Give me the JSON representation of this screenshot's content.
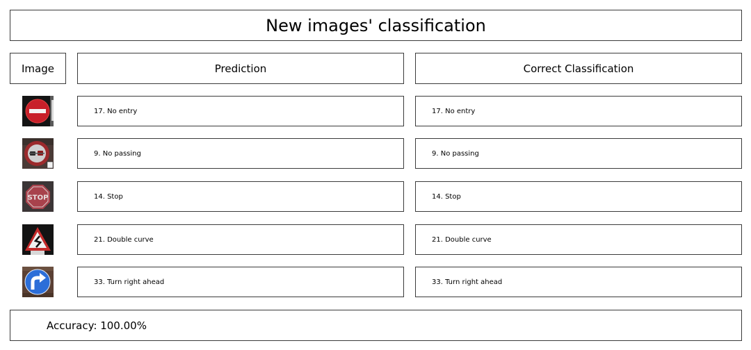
{
  "title": "New images' classification",
  "headers": {
    "image": "Image",
    "prediction": "Prediction",
    "correct": "Correct Classification"
  },
  "rows": [
    {
      "icon": "no-entry-sign-icon",
      "prediction": "17. No entry",
      "correct": "17. No entry"
    },
    {
      "icon": "no-passing-sign-icon",
      "prediction": "9. No passing",
      "correct": "9. No passing"
    },
    {
      "icon": "stop-sign-icon",
      "prediction": "14. Stop",
      "correct": "14. Stop"
    },
    {
      "icon": "double-curve-sign-icon",
      "prediction": "21. Double curve",
      "correct": "21. Double curve"
    },
    {
      "icon": "turn-right-ahead-sign-icon",
      "prediction": "33. Turn right ahead",
      "correct": "33. Turn right ahead"
    }
  ],
  "accuracy": "Accuracy: 100.00%",
  "stop_sign_text": "STOP"
}
